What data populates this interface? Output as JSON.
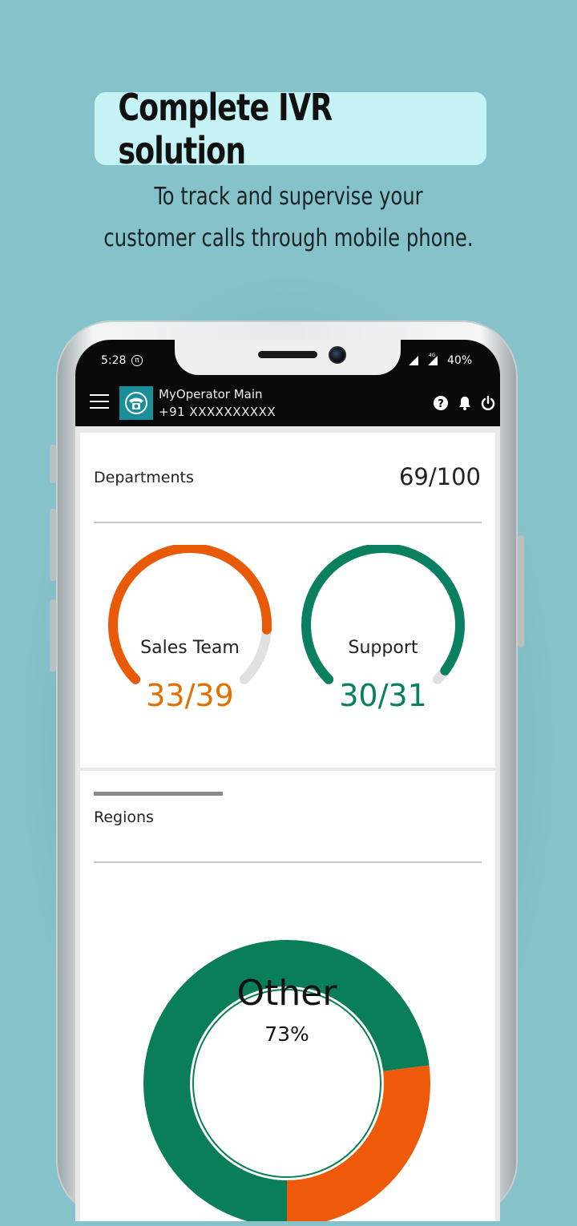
{
  "promo": {
    "headline": "Complete IVR solution",
    "subtitle_line1": "To track and supervise your",
    "subtitle_line2": "customer calls through mobile phone."
  },
  "status_bar": {
    "time": "5:28",
    "network": "4G",
    "battery": "40%"
  },
  "app_bar": {
    "title": "MyOperator Main",
    "number": "+91 XXXXXXXXXX",
    "icons": [
      "menu-icon",
      "help-icon",
      "bell-icon",
      "power-icon"
    ]
  },
  "departments": {
    "label": "Departments",
    "count": "69/100",
    "gauges": [
      {
        "name": "Sales Team",
        "value": "33/39",
        "fraction": 0.846,
        "color": "#e85a08"
      },
      {
        "name": "Support",
        "value": "30/31",
        "fraction": 0.968,
        "color": "#0a8060"
      }
    ],
    "track_color": "#e0e0e0"
  },
  "regions": {
    "label": "Regions",
    "center_title": "Other",
    "center_value": "73%",
    "segments": [
      {
        "name": "Other",
        "percent": 73,
        "color": "#0a7e58"
      },
      {
        "name": "",
        "percent": 27,
        "color": "#ef5a0a"
      }
    ]
  },
  "colors": {
    "background": "#86c2c9",
    "headline_box": "#c5f3f6",
    "app_bar": "#0a0a0a",
    "logo": "#1b8e9b"
  }
}
